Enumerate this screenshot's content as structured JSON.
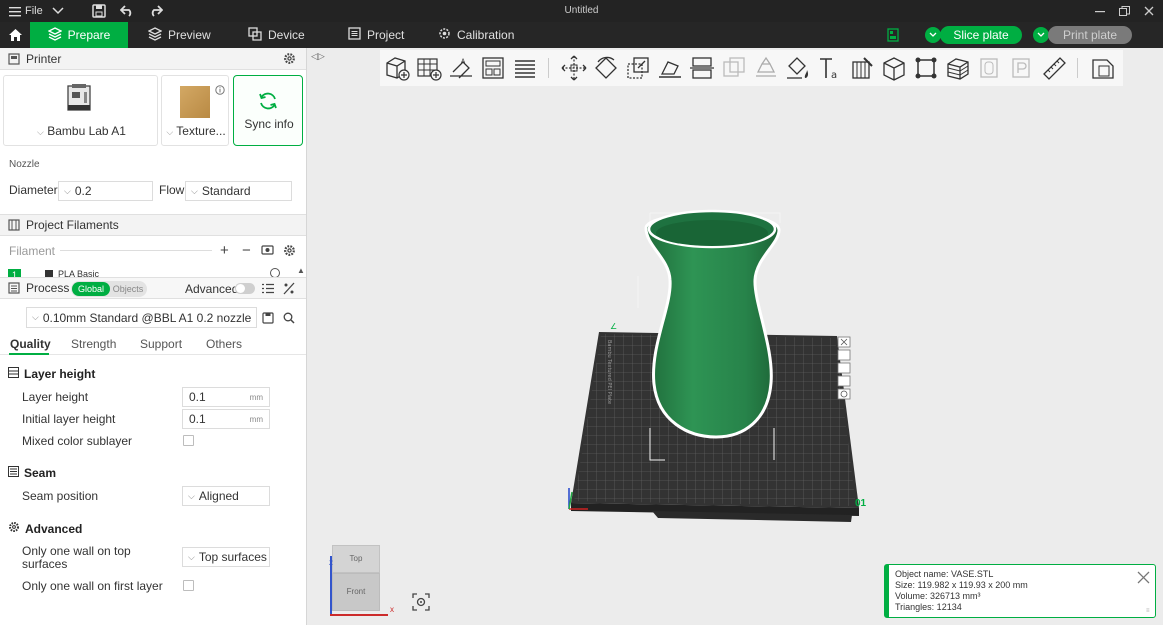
{
  "titlebar": {
    "menu_label": "File",
    "window_title": "Untitled"
  },
  "tabs": [
    {
      "label": "Prepare"
    },
    {
      "label": "Preview"
    },
    {
      "label": "Device"
    },
    {
      "label": "Project"
    },
    {
      "label": "Calibration"
    }
  ],
  "actions": {
    "slice": "Slice plate",
    "print": "Print plate"
  },
  "printer": {
    "section_title": "Printer",
    "printer_name": "Bambu Lab A1",
    "plate_name": "Texture...",
    "sync_label": "Sync info",
    "nozzle_label": "Nozzle",
    "diameter_label": "Diameter",
    "diameter_value": "0.2",
    "flow_label": "Flow",
    "flow_value": "Standard"
  },
  "filaments": {
    "section_title": "Project Filaments",
    "filament_label": "Filament",
    "item_index": "1",
    "item_name": "PLA Basic"
  },
  "process": {
    "section_title": "Process",
    "toggle_global": "Global",
    "toggle_objects": "Objects",
    "advanced_label": "Advanced",
    "preset": "0.10mm Standard @BBL A1 0.2 nozzle",
    "subtabs": [
      "Quality",
      "Strength",
      "Support",
      "Others"
    ],
    "groups": {
      "layer_height": {
        "title": "Layer height",
        "layer_height_label": "Layer height",
        "layer_height_value": "0.1",
        "initial_layer_height_label": "Initial layer height",
        "initial_layer_height_value": "0.1",
        "unit": "mm",
        "mixed_color_label": "Mixed color sublayer"
      },
      "seam": {
        "title": "Seam",
        "seam_position_label": "Seam position",
        "seam_position_value": "Aligned"
      },
      "advanced": {
        "title": "Advanced",
        "one_wall_top_label_line1": "Only one wall on top",
        "one_wall_top_label_line2": "surfaces",
        "one_wall_top_value": "Top surfaces",
        "one_wall_first_label": "Only one wall on first layer"
      }
    }
  },
  "viewport": {
    "plate_number": "01",
    "view_cube_top": "Top",
    "view_cube_front": "Front",
    "axis_x": "x",
    "axis_z": "z"
  },
  "object_info": {
    "name_line": "Object name: VASE.STL",
    "size_line": "Size: 119.982 x 119.93 x 200 mm",
    "volume_line": "Volume: 326713 mm³",
    "triangles_line": "Triangles: 12134"
  },
  "colors": {
    "accent": "#00ae42",
    "vase": "#2e8b4e",
    "bed": "#3a3a3a",
    "topbar": "#232323"
  }
}
